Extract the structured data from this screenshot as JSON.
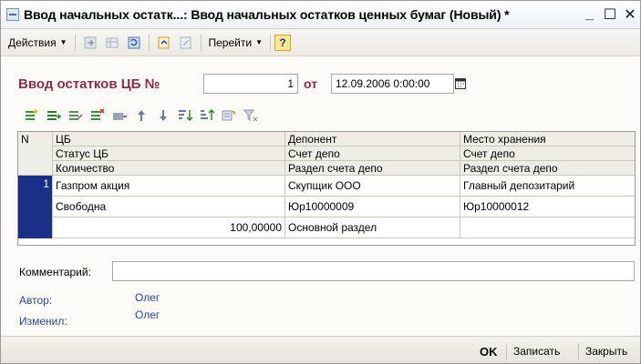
{
  "window": {
    "title": "Ввод начальных остатк...: Ввод начальных остатков ценных бумаг (Новый) *",
    "minimize": "_",
    "maximize": "☐",
    "close": "✕"
  },
  "toolbar": {
    "actions_label": "Действия",
    "goto_label": "Перейти",
    "help_label": "?"
  },
  "header": {
    "doc_title": "Ввод остатков ЦБ №",
    "number": "1",
    "date_label": "от",
    "date_value": "12.09.2006  0:00:00"
  },
  "table": {
    "columns_row1": [
      "N",
      "ЦБ",
      "Депонент",
      "Место хранения"
    ],
    "columns_row2": [
      "Статус ЦБ",
      "Счет депо",
      "Счет депо"
    ],
    "columns_row3": [
      "Количество",
      "Раздел счета депо",
      "Раздел счета депо"
    ],
    "rows": [
      {
        "n": "1",
        "line1": [
          "Газпром акция",
          "Скупщик ООО",
          "Главный депозитарий"
        ],
        "line2": [
          "Свободна",
          "Юр10000009",
          "Юр10000012"
        ],
        "line3": [
          "100,00000",
          "Основной раздел",
          ""
        ]
      }
    ]
  },
  "comment": {
    "label": "Комментарий:",
    "value": ""
  },
  "meta": {
    "author_label": "Автор:",
    "author_value": "Олег",
    "changed_label": "Изменил:",
    "changed_value": "Олег"
  },
  "buttons": {
    "ok": "OK",
    "save": "Записать",
    "close": "Закрыть"
  },
  "colors": {
    "title_accent": "#8b2d4f",
    "selected_row": "#1a2f86",
    "meta_text": "#2b4a8f"
  }
}
